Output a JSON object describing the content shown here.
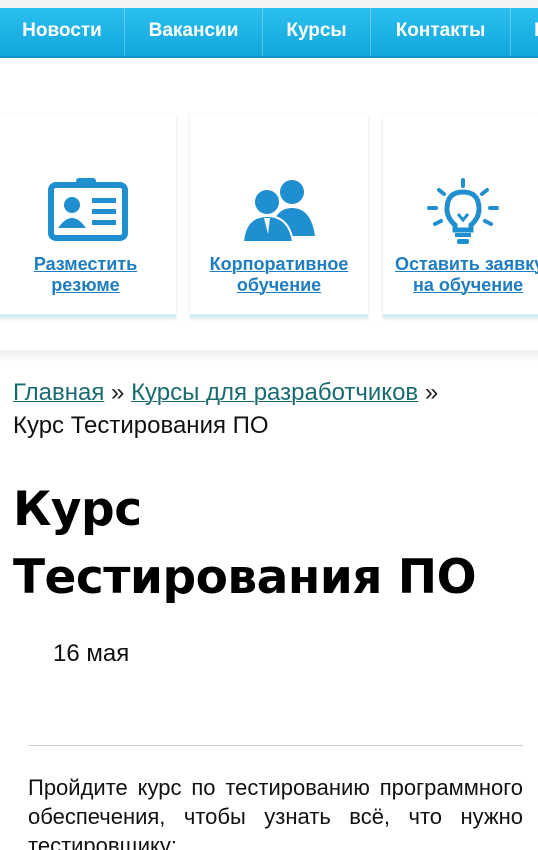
{
  "nav": {
    "items": [
      "Новости",
      "Вакансии",
      "Курсы",
      "Контакты",
      "П"
    ]
  },
  "cards": [
    {
      "icon": "id-card-icon",
      "label_line1": "Разместить",
      "label_line2": "резюме"
    },
    {
      "icon": "people-icon",
      "label_line1": "Корпоративное",
      "label_line2": "обучение"
    },
    {
      "icon": "lightbulb-icon",
      "label_line1": "Оставить заявку",
      "label_line2": "на обучение"
    }
  ],
  "breadcrumb": {
    "home": "Главная",
    "sep": "»",
    "category": "Курсы для разработчиков",
    "current": "Курс Тестирования ПО"
  },
  "article": {
    "title": "Курс Тестирования ПО",
    "date": "16 мая",
    "intro": "Пройдите курс по тестированию программного обеспечения, чтобы узнать всё, что нужно тестировщику:"
  },
  "colors": {
    "nav_bg": "#1ab0e4",
    "card_text": "#1f7dc2",
    "icon": "#1f8fd0",
    "link": "#1a6b70"
  }
}
